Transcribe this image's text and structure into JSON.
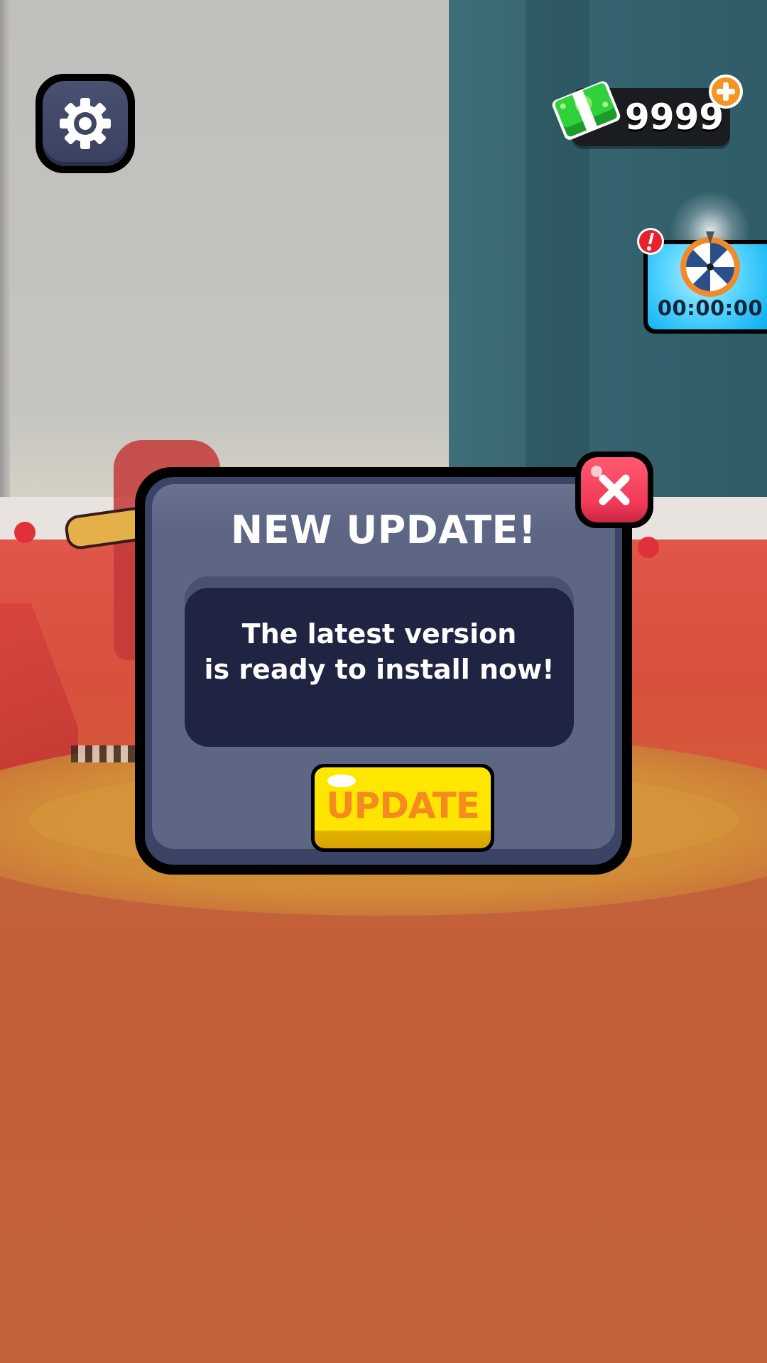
{
  "hud": {
    "settings_icon": "gear-icon",
    "currency": {
      "icon": "cash-stack-icon",
      "value": "9999",
      "add_icon": "plus-icon"
    },
    "spin_wheel": {
      "icon": "prize-wheel-icon",
      "timer": "00:00:00",
      "alert_icon": "exclamation-icon"
    }
  },
  "modal": {
    "title": "NEW UPDATE!",
    "message": "The latest version\nis ready to install now!",
    "update_button_label": "UPDATE",
    "close_icon": "close-icon"
  },
  "colors": {
    "modal_body": "#5d6684",
    "modal_frame": "#3b4466",
    "message_box": "#1f2442",
    "update_button": "#ffe400",
    "update_label": "#f58a1f",
    "close_button": "#f23a58",
    "spin_widget": "#19b5f3",
    "currency_pill": "#1a1c20"
  }
}
